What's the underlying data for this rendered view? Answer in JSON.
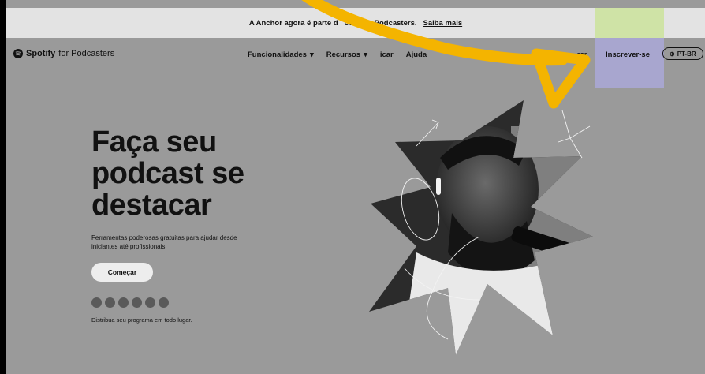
{
  "announcement": {
    "text_before": "A Anchor agora é parte d",
    "text_after": "otify for Podcasters.",
    "link": "Saiba mais"
  },
  "nav": {
    "logo_word": "Spotify",
    "logo_suffix": "for Podcasters",
    "menu": [
      {
        "label": "Funcionalidades",
        "dropdown": true
      },
      {
        "label": "Recursos",
        "dropdown": true
      },
      {
        "label": "icar",
        "dropdown": false
      },
      {
        "label": "Ajuda",
        "dropdown": false
      }
    ],
    "right_partial": "...rar",
    "signup": "Inscrever-se",
    "language": "PT-BR"
  },
  "hero": {
    "title_lines": [
      "Faça seu",
      "podcast se",
      "destacar"
    ],
    "subtitle": "Ferramentas poderosas gratuitas para ajudar desde iniciantes até profissionais.",
    "cta": "Começar",
    "distribution_text": "Distribua seu programa em todo lugar.",
    "platform_icons": [
      "spotify-icon",
      "apple-podcasts-icon",
      "google-podcasts-icon",
      "amazon-music-icon",
      "pocket-casts-icon",
      "castbox-icon"
    ]
  },
  "colors": {
    "page_bg": "#9a9a9a",
    "banner_bg": "#e3e3e3",
    "arrow": "#f4b400",
    "highlight_green": "#cfe3a6",
    "highlight_purple": "#a8a6cf"
  }
}
